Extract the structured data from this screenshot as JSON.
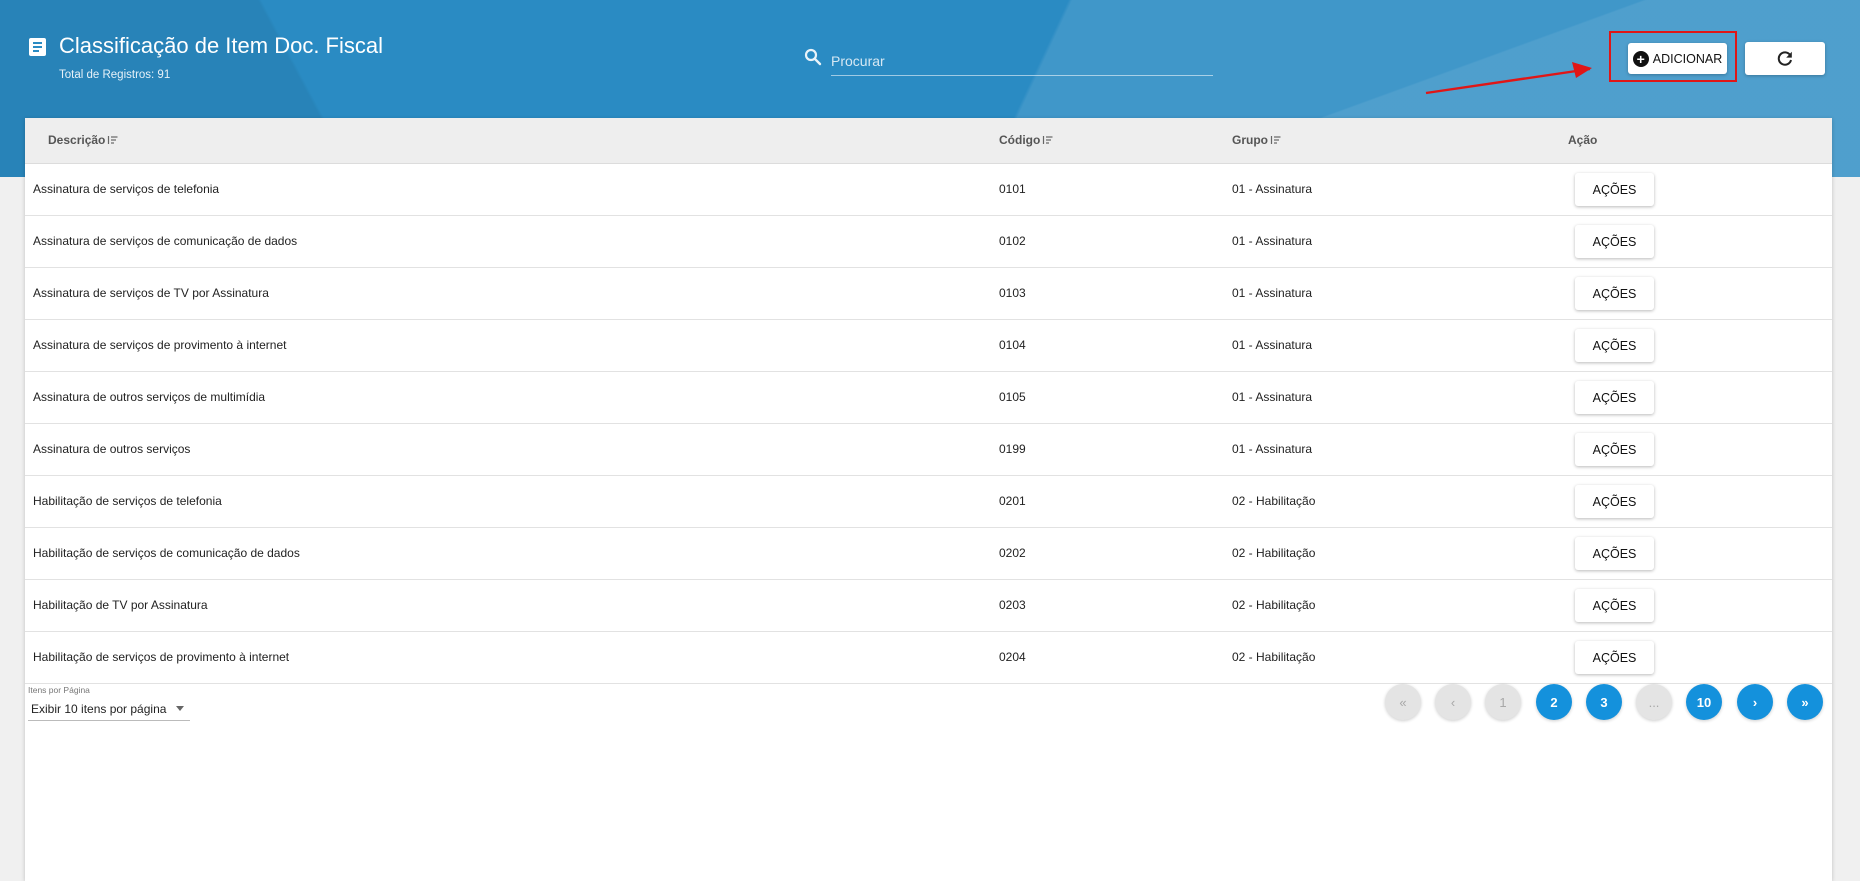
{
  "header": {
    "title": "Classificação de Item Doc. Fiscal",
    "record_count": "Total de Registros: 91",
    "search_placeholder": "Procurar",
    "add_label": "ADICIONAR"
  },
  "table": {
    "columns": [
      "Descrição",
      "Código",
      "Grupo",
      "Ação"
    ],
    "action_label": "AÇÕES",
    "rows": [
      {
        "descricao": "Assinatura de serviços de telefonia",
        "codigo": "0101",
        "grupo": "01 - Assinatura"
      },
      {
        "descricao": "Assinatura de serviços de comunicação de dados",
        "codigo": "0102",
        "grupo": "01 - Assinatura"
      },
      {
        "descricao": "Assinatura de serviços de TV por Assinatura",
        "codigo": "0103",
        "grupo": "01 - Assinatura"
      },
      {
        "descricao": "Assinatura de serviços de provimento à internet",
        "codigo": "0104",
        "grupo": "01 - Assinatura"
      },
      {
        "descricao": "Assinatura de outros serviços de multimídia",
        "codigo": "0105",
        "grupo": "01 - Assinatura"
      },
      {
        "descricao": "Assinatura de outros serviços",
        "codigo": "0199",
        "grupo": "01 - Assinatura"
      },
      {
        "descricao": "Habilitação de serviços de telefonia",
        "codigo": "0201",
        "grupo": "02 - Habilitação"
      },
      {
        "descricao": "Habilitação de serviços de comunicação de dados",
        "codigo": "0202",
        "grupo": "02 - Habilitação"
      },
      {
        "descricao": "Habilitação de TV por Assinatura",
        "codigo": "0203",
        "grupo": "02 - Habilitação"
      },
      {
        "descricao": "Habilitação de serviços de provimento à internet",
        "codigo": "0204",
        "grupo": "02 - Habilitação"
      }
    ]
  },
  "footer": {
    "items_per_page_label": "Itens por Página",
    "items_per_page_value": "Exibir 10 itens por página",
    "pagination": [
      {
        "label": "«",
        "enabled": false
      },
      {
        "label": "‹",
        "enabled": false
      },
      {
        "label": "1",
        "enabled": false
      },
      {
        "label": "2",
        "enabled": true
      },
      {
        "label": "3",
        "enabled": true
      },
      {
        "label": "...",
        "enabled": false
      },
      {
        "label": "10",
        "enabled": true
      },
      {
        "label": "›",
        "enabled": true
      },
      {
        "label": "»",
        "enabled": true
      }
    ]
  },
  "colors": {
    "header_blue": "#2a8bc3",
    "page_button_active": "#1491dc",
    "highlight_red": "#e01616"
  }
}
